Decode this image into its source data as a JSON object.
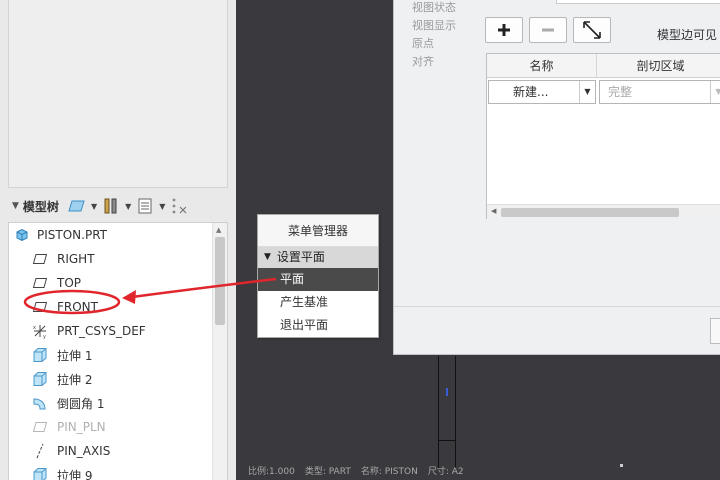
{
  "colors": {
    "annotation_red": "#e0262c",
    "graphics_bg": "#3a3a3e",
    "menu_active_bg": "#4a4a4a"
  },
  "model_tree": {
    "toolbar": {
      "title": "模型树",
      "icons": [
        "show-icon",
        "settings-icon",
        "columns-icon",
        "filter-icon"
      ]
    },
    "items": [
      {
        "label": "PISTON.PRT",
        "icon": "part-icon",
        "level": "root"
      },
      {
        "label": "RIGHT",
        "icon": "datum-plane-icon",
        "level": "child"
      },
      {
        "label": "TOP",
        "icon": "datum-plane-icon",
        "level": "child"
      },
      {
        "label": "FRONT",
        "icon": "datum-plane-icon",
        "level": "child"
      },
      {
        "label": "PRT_CSYS_DEF",
        "icon": "csys-icon",
        "level": "child"
      },
      {
        "label": "拉伸 1",
        "icon": "extrude-icon",
        "level": "child"
      },
      {
        "label": "拉伸 2",
        "icon": "extrude-icon",
        "level": "child"
      },
      {
        "label": "倒圆角 1",
        "icon": "round-icon",
        "level": "child"
      },
      {
        "label": "PIN_PLN",
        "icon": "datum-plane-icon",
        "level": "child",
        "dimmed": true
      },
      {
        "label": "PIN_AXIS",
        "icon": "axis-icon",
        "level": "child"
      },
      {
        "label": "拉伸 9",
        "icon": "extrude-icon",
        "level": "child"
      }
    ]
  },
  "menu_manager": {
    "title": "菜单管理器",
    "section": "设置平面",
    "items": [
      {
        "label": "平面",
        "active": true
      },
      {
        "label": "产生基准",
        "active": false
      },
      {
        "label": "退出平面",
        "active": false
      }
    ]
  },
  "view_dialog": {
    "tabs": [
      "视图状态",
      "视图显示",
      "原点",
      "对齐"
    ],
    "visible_label": "模型边可见",
    "table": {
      "headers": [
        "名称",
        "剖切区域"
      ],
      "row": {
        "name": "新建...",
        "section": "完整"
      }
    }
  },
  "status_bar": {
    "scale": "比例:1.000",
    "type": "类型: PART",
    "name": "名称: PISTON",
    "size": "尺寸: A2"
  }
}
